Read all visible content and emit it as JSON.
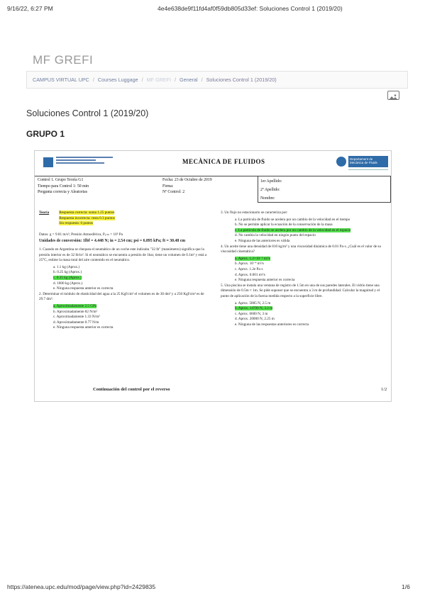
{
  "print_header": {
    "datetime": "9/16/22, 6:27 PM",
    "doc_title": "4e4e638de9f11fd4af0f59db805d33ef: Soluciones Control 1 (2019/20)"
  },
  "site": {
    "title": "MF GREFI"
  },
  "breadcrumb": {
    "items": [
      "CAMPUS VIRTUAL UPC",
      "Courses Luggage",
      "MF GREFI",
      "General",
      "Soluciones Control 1 (2019/20)"
    ],
    "separator": "/"
  },
  "page": {
    "title": "Soluciones Control 1 (2019/20)",
    "group": "GRUPO 1"
  },
  "exam": {
    "title": "MECÀNICA DE FLUIDOS",
    "dept": "Departament de Mecànica de Fluids",
    "info_left": [
      "Control 1. Grupo Teoría G1",
      "Tiempo para Control 1: 50 min",
      "Pregunta correcta y Aleatorias"
    ],
    "info_mid": [
      "Fecha: 23 de Octubre de 2019",
      "Firma:",
      "Nº Control: 2"
    ],
    "info_right": [
      "1er Apellido:",
      "2º Apellido:",
      "Nombre:"
    ],
    "criteria_label": "Teoría",
    "criteria": [
      "Respuesta correcta: suma 1.25 puntos",
      "Respuesta incorrecta: resta 0.3 puntos",
      "Sin respuesta: 0 puntos"
    ],
    "data_line": "Datos: g = 9.81 m/s²; Presión Atmosférica, Pₐₜₘ = 10⁵ Pa",
    "conv_line": "Unidades de conversión: 1lbf = 4.448 N; in = 2.54 cm; psi = 6.895 kPa; ft = 30.48 cm",
    "q1": "1. Cuando en Argentina se chequea el neumático de un coche este indicaba \"32 lb\" (manómetro) significa que la presión interior es de 32 lb/in². Si el neumático se encuentra a presión de 1bar, tiene un volumen de 0.1m³ y está a 25°C, estime la masa total del aire contenido en el neumático.",
    "q1_opts": [
      "a. 1.1 kg (Aprox.)",
      "b. 0.25 kg (Aprox.)",
      "c. 0.35 kg (Aprox.)",
      "d. 1000 kg (Aprox.)",
      "e. Ninguna respuesta anterior es correcta"
    ],
    "q2": "2. Determinar el módulo de elasticidad del agua a la 25 Kgf/cm² el volumen es de 30 dm³ y a 250 Kgf/cm² es de 29.7 dm³.",
    "q2_opts": [
      "a. Aproximadamente 2.5 GPa",
      "b. Aproximadamente 82 N/m²",
      "c. Aproximadamente 1.33 N/m²",
      "d. Aproximadamente 0.77 N/m",
      "e. Ninguna respuesta anterior es correcta"
    ],
    "q3": "3. Un flujo no estacionario se caracteriza por:",
    "q3_opts": [
      "a. La partícula de fluido se acelera por un cambio de la velocidad en el tiempo",
      "b. No se permite aplicar la ecuación de la conservación de la masa",
      "c. La partícula de fluido se acelera por un cambio de la velocidad en el espacio",
      "d. No cambia la velocidad en ningún punto del espacio",
      "e. Ninguna de las anteriores es válida"
    ],
    "q4": "4. Un aceite tiene una densidad de 810 kg/m³ y una viscosidad dinámica de 0.01 Pa·s. ¿Cuál es el valor de su viscosidad cinemática?",
    "q4_opts": [
      "a. Aprox. 1.2×10⁻⁵ m²/s",
      "b. Aprox. 10⁻⁴ m²/s",
      "c. Aprox. 1.2e Pa·s",
      "d. Aprox. 0.001 m²/s",
      "e. Ninguna respuesta anterior es correcta"
    ],
    "q5": "5. Una piscina se instala una ventana de registro de 1.5m en una de sus paredes laterales. El vidrio tiene una dimensión de 0.5m × 1m. Se pide suponer que se encuentra a 3 m de profundidad. Calcular la magnitud y el punto de aplicación de la fuerza medida respecto a la superficie libre.",
    "q5_opts": [
      "a. Aprox. 5885 N, 2.5 m",
      "b. Aprox. 14700 N, 3.2 m",
      "c. Aprox. 6600 N, 3 m",
      "d. Aprox. 20000 N, 2.25 m",
      "e. Ninguna de las respuestas anteriores es correcta"
    ],
    "footer": "Continuación del control por el reverso",
    "page": "1/2"
  },
  "print_footer": {
    "url": "https://atenea.upc.edu/mod/page/view.php?id=2429835",
    "page": "1/6"
  }
}
